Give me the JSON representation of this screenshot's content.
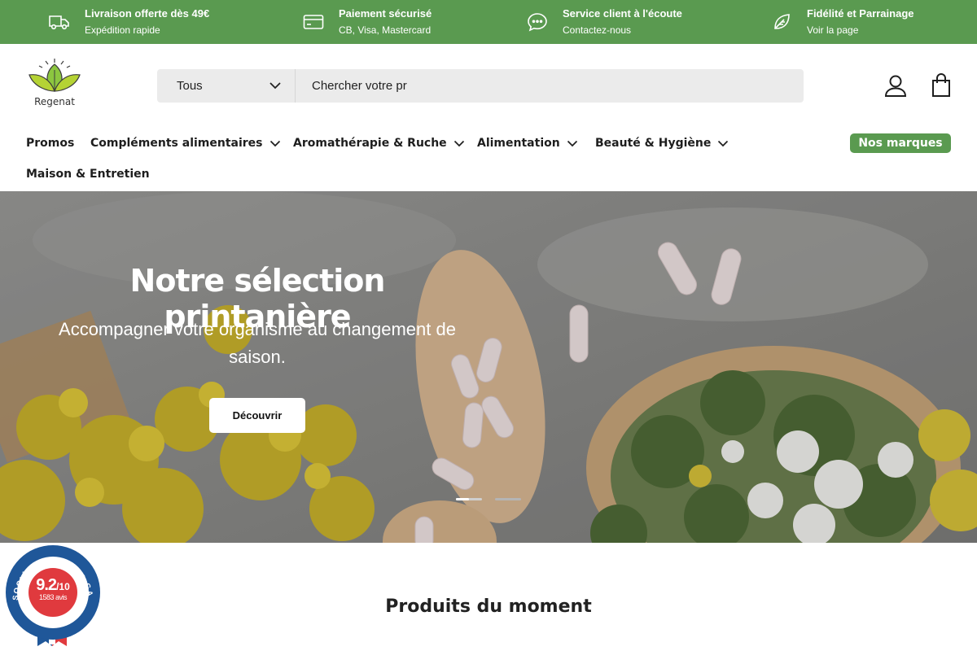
{
  "benefits": [
    {
      "title": "Livraison offerte dès 49€",
      "subtitle": "Expédition rapide",
      "icon": "truck-icon"
    },
    {
      "title": "Paiement sécurisé",
      "subtitle": "CB, Visa, Mastercard",
      "icon": "credit-card-icon"
    },
    {
      "title": "Service client à l'écoute",
      "subtitle": "Contactez-nous",
      "icon": "chat-icon"
    },
    {
      "title": "Fidélité et Parrainage",
      "subtitle": "Voir la page",
      "icon": "leaf-icon"
    }
  ],
  "logo": {
    "text": "Regenat"
  },
  "search": {
    "category": "Tous",
    "value": "Chercher votre pr"
  },
  "header_icons": [
    "account-icon",
    "cart-icon"
  ],
  "nav": {
    "items": [
      {
        "label": "Promos",
        "has_dropdown": false
      },
      {
        "label": "Compléments alimentaires",
        "has_dropdown": true
      },
      {
        "label": "Aromathérapie & Ruche",
        "has_dropdown": true
      },
      {
        "label": "Alimentation",
        "has_dropdown": true
      },
      {
        "label": "Beauté & Hygiène",
        "has_dropdown": true
      },
      {
        "label": "Maison & Entretien",
        "has_dropdown": false
      }
    ],
    "brands_label": "Nos marques"
  },
  "hero": {
    "title": "Notre sélection printanière",
    "subtitle": "Accompagner votre organisme au changement de saison.",
    "button_label": "Découvrir",
    "slide_count": 2,
    "active_slide": 1
  },
  "section": {
    "title": "Produits du moment"
  },
  "review_badge": {
    "ring_text": "SOCIÉTÉ DES AVIS GARANTIS",
    "score": "9.2",
    "scale": "/10",
    "count": "1583 avis"
  },
  "colors": {
    "brand_green": "#5a9a50",
    "search_bg": "#ebebeb",
    "badge_blue": "#1f5799",
    "badge_red": "#e03a3e"
  }
}
